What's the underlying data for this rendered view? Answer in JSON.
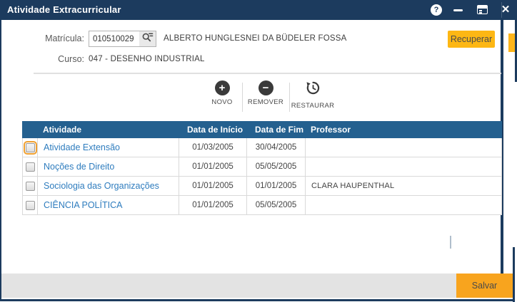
{
  "window": {
    "title": "Atividade Extracurricular",
    "controls": {
      "help_glyph": "?",
      "close_glyph": "✕"
    }
  },
  "form": {
    "matricula_label": "Matrícula:",
    "matricula_value": "010510029",
    "student_name": "ALBERTO HUNGLESNEI DA BÜDELER FOSSA",
    "curso_label": "Curso:",
    "curso_value": "047 - DESENHO INDUSTRIAL",
    "recuperar_label": "Recuperar"
  },
  "toolbar": {
    "novo_label": "NOVO",
    "novo_glyph": "+",
    "remover_label": "REMOVER",
    "remover_glyph": "−",
    "restaurar_label": "RESTAURAR"
  },
  "table": {
    "columns": [
      "",
      "Atividade",
      "Data de Início",
      "Data de Fim",
      "Professor"
    ],
    "rows": [
      {
        "checked": false,
        "focused": true,
        "atividade": "Atividade Extensão",
        "inicio": "01/03/2005",
        "fim": "30/04/2005",
        "professor": ""
      },
      {
        "checked": false,
        "focused": false,
        "atividade": "Noções de Direito",
        "inicio": "01/01/2005",
        "fim": "05/05/2005",
        "professor": ""
      },
      {
        "checked": false,
        "focused": false,
        "atividade": "Sociologia das Organizações",
        "inicio": "01/01/2005",
        "fim": "01/01/2005",
        "professor": "CLARA HAUPENTHAL"
      },
      {
        "checked": false,
        "focused": false,
        "atividade": "CIÊNCIA POLÍTICA",
        "inicio": "01/01/2005",
        "fim": "05/05/2005",
        "professor": ""
      }
    ]
  },
  "footer": {
    "salvar_label": "Salvar"
  },
  "colors": {
    "titlebar": "#1c3b5e",
    "table_header": "#24608f",
    "link_blue": "#2e7cbe",
    "recuperar_yellow": "#fdb714",
    "salvar_amber": "#f8a41e",
    "focus_orange": "#f0a030",
    "footer_gray": "#e3e3e3"
  }
}
